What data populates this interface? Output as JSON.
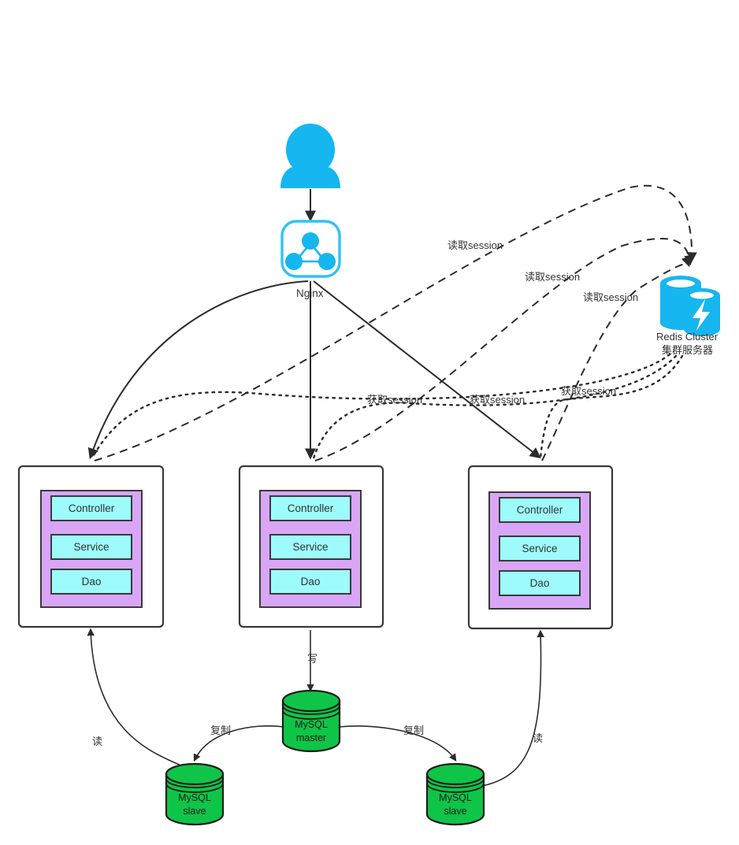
{
  "diagram": {
    "title": "Nginx load balanced cluster with Redis session sharing and MySQL master-slave",
    "colors": {
      "accent_blue": "#16b6f0",
      "app_panel_purple": "#d9a6f7",
      "layer_cyan": "#9dfbfb",
      "mysql_green": "#0fc548",
      "line_dark": "#2b2b2b"
    }
  },
  "nodes": {
    "user": {
      "icon": "user-icon",
      "label": ""
    },
    "nginx": {
      "icon": "nginx-icon",
      "label": "Nginx"
    },
    "redis": {
      "icon": "redis-cluster-icon",
      "label_en": "Redis Cluster",
      "label_cn": "集群服务器"
    },
    "app_servers": [
      {
        "id": "app-server-1",
        "layers": [
          {
            "label": "Controller"
          },
          {
            "label": "Service"
          },
          {
            "label": "Dao"
          }
        ]
      },
      {
        "id": "app-server-2",
        "layers": [
          {
            "label": "Controller"
          },
          {
            "label": "Service"
          },
          {
            "label": "Dao"
          }
        ]
      },
      {
        "id": "app-server-3",
        "layers": [
          {
            "label": "Controller"
          },
          {
            "label": "Service"
          },
          {
            "label": "Dao"
          }
        ]
      }
    ],
    "databases": [
      {
        "id": "mysql-master",
        "line1": "MySQL",
        "line2": "master"
      },
      {
        "id": "mysql-slave-left",
        "line1": "MySQL",
        "line2": "slave"
      },
      {
        "id": "mysql-slave-right",
        "line1": "MySQL",
        "line2": "slave"
      }
    ]
  },
  "edges": {
    "write_session": [
      {
        "id": "write-session-1",
        "label": "读取session"
      },
      {
        "id": "write-session-2",
        "label": "读取session"
      },
      {
        "id": "write-session-3",
        "label": "读取session"
      }
    ],
    "fetch_session": [
      {
        "id": "fetch-session-1",
        "label": "获取session"
      },
      {
        "id": "fetch-session-2",
        "label": "获取session"
      },
      {
        "id": "fetch-session-3",
        "label": "获取session"
      }
    ],
    "db_ops": [
      {
        "id": "db-read-left",
        "label": "读"
      },
      {
        "id": "db-write",
        "label": "写"
      },
      {
        "id": "db-replicate-left",
        "label": "复制"
      },
      {
        "id": "db-replicate-right",
        "label": "复制"
      },
      {
        "id": "db-read-right",
        "label": "读"
      }
    ]
  }
}
